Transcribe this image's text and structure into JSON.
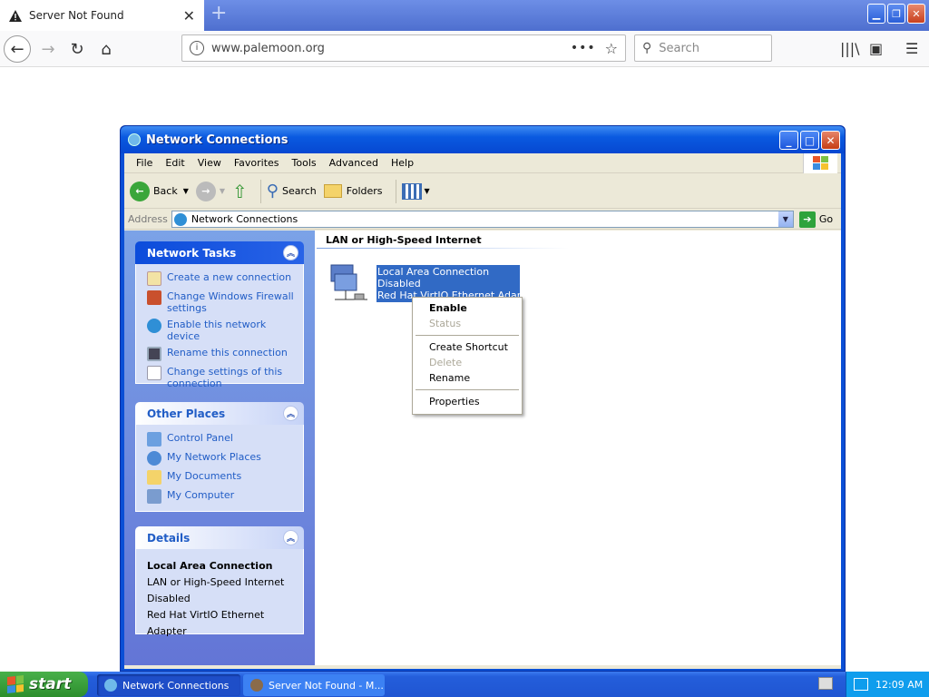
{
  "browser": {
    "tab_title": "Server Not Found",
    "tab_close": "✕",
    "new_tab": "+",
    "url": "www.palemoon.org",
    "search_placeholder": "Search",
    "win_minimize": "▁",
    "win_restore": "❐",
    "win_close": "✕"
  },
  "window": {
    "title": "Network Connections",
    "min": "_",
    "max": "□",
    "close": "✕"
  },
  "menu": [
    "File",
    "Edit",
    "View",
    "Favorites",
    "Tools",
    "Advanced",
    "Help"
  ],
  "toolbar": {
    "back": "Back",
    "search": "Search",
    "folders": "Folders"
  },
  "address": {
    "label": "Address",
    "value": "Network Connections",
    "go": "Go"
  },
  "network_tasks": {
    "title": "Network Tasks",
    "items": [
      "Create a new connection",
      "Change Windows Firewall settings",
      "Enable this network device",
      "Rename this connection",
      "Change settings of this connection"
    ]
  },
  "other_places": {
    "title": "Other Places",
    "items": [
      "Control Panel",
      "My Network Places",
      "My Documents",
      "My Computer"
    ]
  },
  "details": {
    "title": "Details",
    "name": "Local Area Connection",
    "type": "LAN or High-Speed Internet",
    "status": "Disabled",
    "adapter": "Red Hat VirtIO Ethernet Adapter"
  },
  "content": {
    "group": "LAN or High-Speed Internet",
    "conn_name": "Local Area Connection",
    "conn_status": "Disabled",
    "conn_adapter": "Red Hat VirtIO Ethernet Adapter"
  },
  "context_menu": {
    "enable": "Enable",
    "status": "Status",
    "create_shortcut": "Create Shortcut",
    "delete": "Delete",
    "rename": "Rename",
    "properties": "Properties"
  },
  "taskbar": {
    "start": "start",
    "task1": "Network Connections",
    "task2": "Server Not Found - M...",
    "clock": "12:09 AM"
  }
}
